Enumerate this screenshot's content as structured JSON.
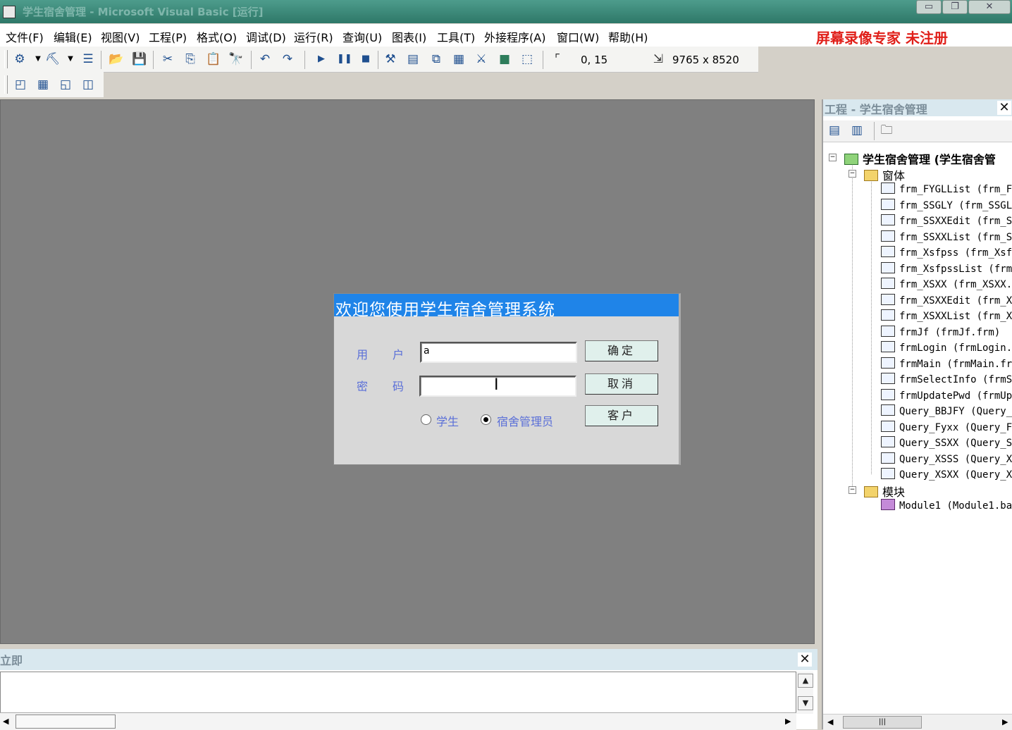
{
  "window": {
    "title": "学生宿舍管理 - Microsoft Visual Basic [运行]",
    "controls": {
      "minimize": "▭",
      "restore": "❐",
      "close": "✕"
    }
  },
  "menu": {
    "items": [
      "文件(F)",
      "编辑(E)",
      "视图(V)",
      "工程(P)",
      "格式(O)",
      "调试(D)",
      "运行(R)",
      "查询(U)",
      "图表(I)",
      "工具(T)",
      "外接程序(A)",
      "窗口(W)",
      "帮助(H)"
    ],
    "registration": "屏幕录像专家  未注册"
  },
  "toolbar": {
    "position": "0, 15",
    "size": "9765 x 8520"
  },
  "dialog": {
    "title": "欢迎您使用学生宿舍管理系统",
    "user_label_1": "用",
    "user_label_2": "户",
    "pwd_label_1": "密",
    "pwd_label_2": "码",
    "user_value": "a",
    "pwd_value": "",
    "ok": "确定",
    "cancel": "取消",
    "client": "客户",
    "radio_student": "学生",
    "radio_admin": "宿舍管理员",
    "selected": "admin"
  },
  "project": {
    "title": "工程 - 学生宿舍管理",
    "root": "学生宿舍管理 (学生宿舍管",
    "forms_folder": "窗体",
    "forms": [
      "frm_FYGLList (frm_F",
      "frm_SSGLY (frm_SSGL",
      "frm_SSXXEdit (frm_S",
      "frm_SSXXList (frm_S",
      "frm_Xsfpss (frm_Xsf",
      "frm_XsfpssList (frm",
      "frm_XSXX (frm_XSXX.",
      "frm_XSXXEdit (frm_X",
      "frm_XSXXList (frm_X",
      "frmJf (frmJf.frm)",
      "frmLogin (frmLogin.",
      "frmMain (frmMain.fr",
      "frmSelectInfo (frmS",
      "frmUpdatePwd (frmUp",
      "Query_BBJFY (Query_",
      "Query_Fyxx (Query_F",
      "Query_SSXX (Query_S",
      "Query_XSSS (Query_X",
      "Query_XSXX (Query_X"
    ],
    "modules_folder": "模块",
    "modules": [
      "Module1 (Module1.ba"
    ]
  },
  "immediate": {
    "title": "立即"
  }
}
